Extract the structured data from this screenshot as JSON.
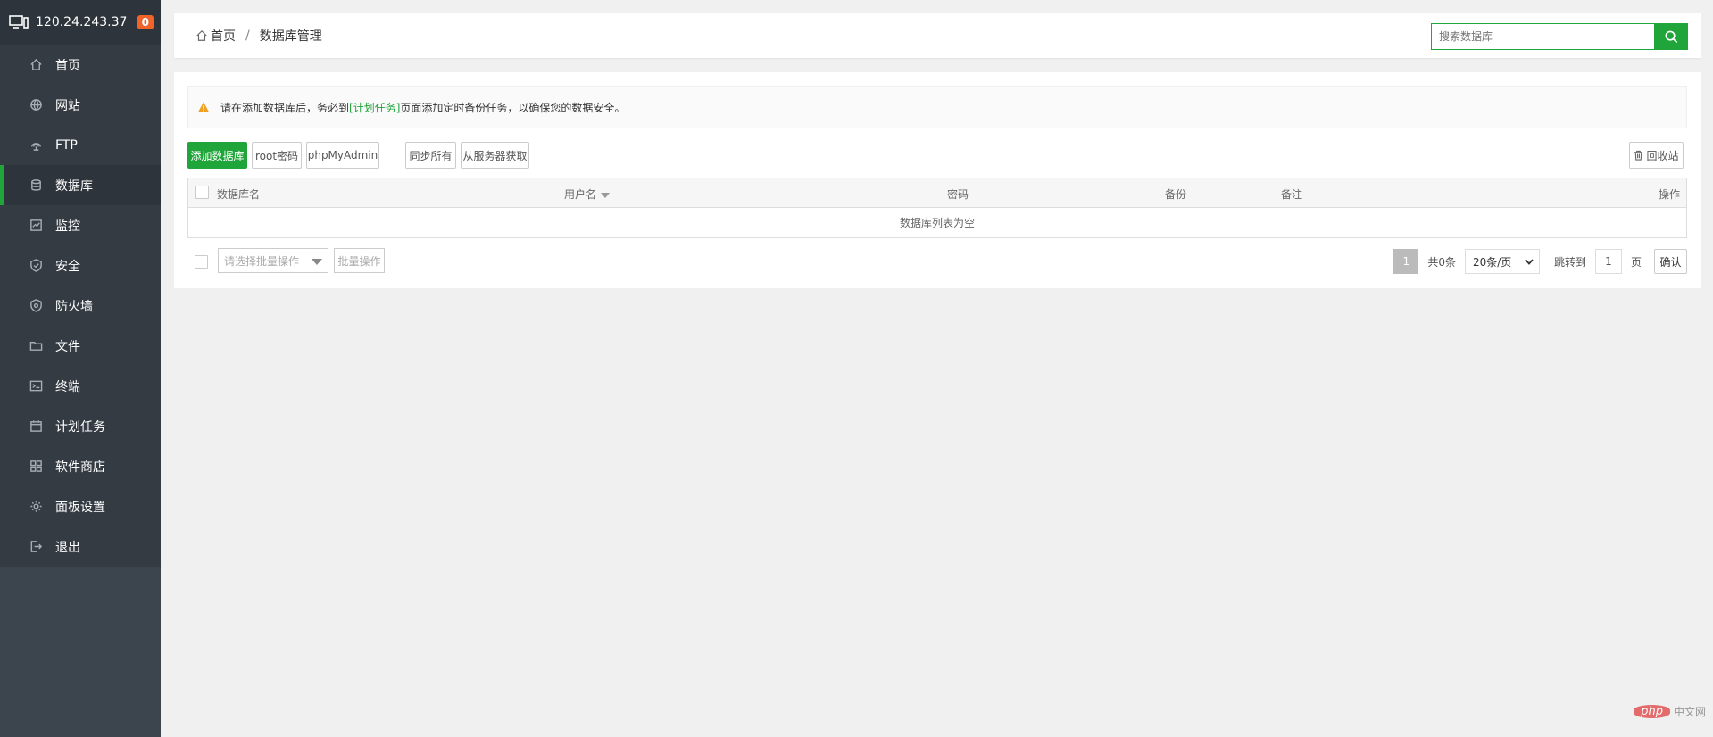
{
  "sidebar": {
    "host": "120.24.243.37",
    "badge": "0",
    "items": [
      {
        "label": "首页",
        "icon": "home-icon",
        "active": false
      },
      {
        "label": "网站",
        "icon": "globe-icon",
        "active": false
      },
      {
        "label": "FTP",
        "icon": "ftp-icon",
        "active": false
      },
      {
        "label": "数据库",
        "icon": "database-icon",
        "active": true
      },
      {
        "label": "监控",
        "icon": "monitor-icon",
        "active": false
      },
      {
        "label": "安全",
        "icon": "shield-icon",
        "active": false
      },
      {
        "label": "防火墙",
        "icon": "firewall-icon",
        "active": false
      },
      {
        "label": "文件",
        "icon": "folder-icon",
        "active": false
      },
      {
        "label": "终端",
        "icon": "terminal-icon",
        "active": false
      },
      {
        "label": "计划任务",
        "icon": "calendar-icon",
        "active": false
      },
      {
        "label": "软件商店",
        "icon": "grid-icon",
        "active": false
      },
      {
        "label": "面板设置",
        "icon": "gear-icon",
        "active": false
      },
      {
        "label": "退出",
        "icon": "logout-icon",
        "active": false
      }
    ]
  },
  "header": {
    "breadcrumb_home": "首页",
    "breadcrumb_sep": "/",
    "breadcrumb_current": "数据库管理",
    "search_placeholder": "搜索数据库"
  },
  "notice": {
    "before": "请在添加数据库后，务必到",
    "link": "[计划任务]",
    "after": "页面添加定时备份任务，以确保您的数据安全。"
  },
  "toolbar": {
    "add_db": "添加数据库",
    "root_pwd": "root密码",
    "phpmyadmin": "phpMyAdmin",
    "sync_all": "同步所有",
    "fetch_server": "从服务器获取",
    "recycle": "回收站"
  },
  "table": {
    "columns": {
      "name": "数据库名",
      "user": "用户名",
      "password": "密码",
      "backup": "备份",
      "note": "备注",
      "actions": "操作"
    },
    "empty": "数据库列表为空"
  },
  "footer": {
    "batch_select_placeholder": "请选择批量操作",
    "batch_button": "批量操作",
    "current_page": "1",
    "total": "共0条",
    "page_size": "20条/页",
    "jump_label": "跳转到",
    "jump_value": "1",
    "page_unit": "页",
    "confirm": "确认"
  },
  "watermark": {
    "brand": "php",
    "text": "中文网"
  },
  "colors": {
    "accent": "#20a53a",
    "sidebar": "#3c444d",
    "badge": "#f0642a",
    "warning": "#f0a020"
  }
}
